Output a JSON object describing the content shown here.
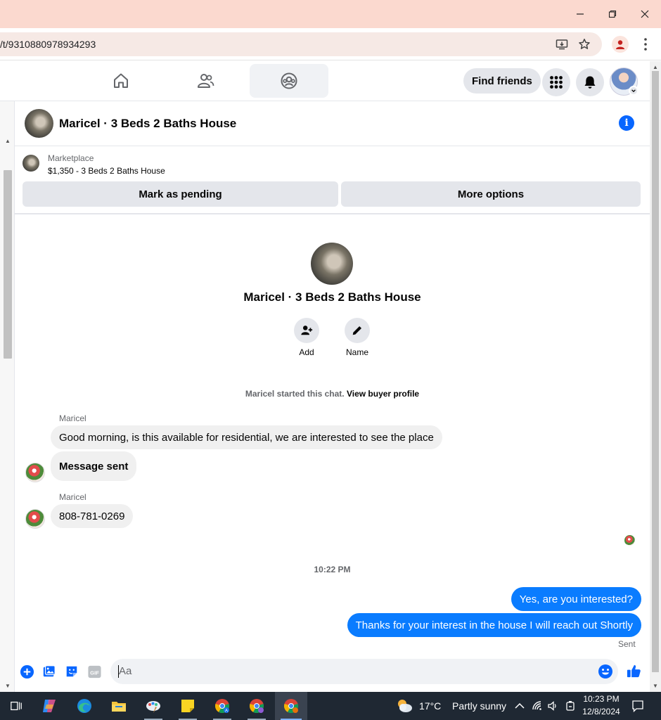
{
  "browser": {
    "url": "/t/9310880978934293",
    "icons": [
      "install-app-icon",
      "bookmark-star-icon",
      "profile-icon",
      "menu-kebab-icon"
    ],
    "window_controls": [
      "minimize-icon",
      "restore-icon",
      "close-icon"
    ]
  },
  "fb_nav": {
    "tabs": [
      "home-icon",
      "friends-icon",
      "groups-icon"
    ],
    "find_friends_label": "Find friends",
    "right_icons": [
      "menu-grid-icon",
      "notifications-bell-icon",
      "account-avatar"
    ]
  },
  "chat": {
    "title": "Maricel · 3 Beds 2 Baths House",
    "marketplace": {
      "label": "Marketplace",
      "item": "$1,350 - 3 Beds 2 Baths House",
      "mark_pending_label": "Mark as pending",
      "more_options_label": "More options"
    },
    "center_name": "Maricel · 3 Beds 2 Baths House",
    "actions": {
      "add_label": "Add",
      "name_label": "Name"
    },
    "started_text": "Maricel started this chat.",
    "view_buyer_profile": "View buyer profile",
    "messages": [
      {
        "sender": "Maricel",
        "text": "Good morning, is this available for residential, we are interested to see the place"
      },
      {
        "text": "Message sent"
      },
      {
        "sender": "Maricel",
        "text": "808-781-0269"
      }
    ],
    "timestamp": "10:22 PM",
    "outgoing": [
      "Yes, are you interested?",
      "Thanks for your interest in the house I will reach out Shortly"
    ],
    "sent_label": "Sent",
    "composer": {
      "placeholder": "Aa",
      "icons": [
        "add-circle-icon",
        "photo-icon",
        "sticker-icon",
        "gif-icon",
        "emoji-icon",
        "thumbs-up-icon"
      ]
    }
  },
  "taskbar": {
    "weather_temp": "17°C",
    "weather_text": "Partly sunny",
    "time": "10:23 PM",
    "date": "12/8/2024"
  },
  "colors": {
    "messenger_blue": "#0a7cff",
    "fb_blue": "#0866ff",
    "titlebar": "#fbd9cf",
    "taskbar": "#1f2833"
  }
}
